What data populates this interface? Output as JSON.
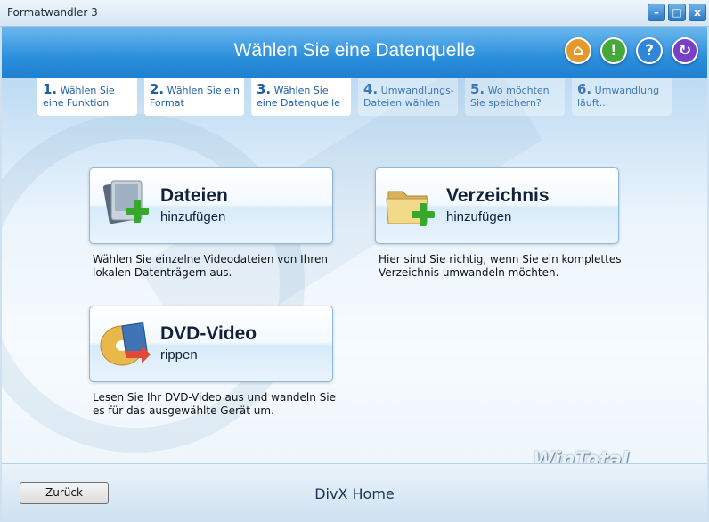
{
  "window": {
    "title": "Formatwandler 3",
    "min": "–",
    "max": "□",
    "close": "x"
  },
  "header": {
    "title": "Wählen Sie eine Datenquelle",
    "icons": [
      "home-icon",
      "info-icon",
      "help-icon",
      "refresh-icon"
    ],
    "icon_glyphs": {
      "home": "⌂",
      "info": "!",
      "help": "?",
      "refresh": "↻"
    },
    "colors": {
      "home": "#e39a2a",
      "info": "#46a83a",
      "help": "#2f85d8",
      "refresh": "#7a3fc7"
    }
  },
  "steps": [
    {
      "num": "1.",
      "label": "Wählen Sie eine Funktion",
      "state": "done"
    },
    {
      "num": "2.",
      "label": "Wählen Sie ein Format",
      "state": "done"
    },
    {
      "num": "3.",
      "label": "Wählen Sie eine Datenquelle",
      "state": "current"
    },
    {
      "num": "4.",
      "label": "Umwandlungs-Dateien wählen",
      "state": "todo"
    },
    {
      "num": "5.",
      "label": "Wo möchten Sie speichern?",
      "state": "todo"
    },
    {
      "num": "6.",
      "label": "Umwandlung läuft...",
      "state": "todo"
    }
  ],
  "options": {
    "files": {
      "title": "Dateien",
      "subtitle": "hinzufügen",
      "description": "Wählen Sie einzelne Videodateien von Ihren lokalen Datenträgern aus."
    },
    "folder": {
      "title": "Verzeichnis",
      "subtitle": "hinzufügen",
      "description": "Hier sind Sie richtig, wenn Sie ein komplettes Verzeichnis umwandeln möchten."
    },
    "dvd": {
      "title": "DVD-Video",
      "subtitle": "rippen",
      "description": "Lesen Sie Ihr DVD-Video aus und wandeln Sie es für das ausgewählte Gerät um."
    }
  },
  "footer": {
    "back": "Zurück",
    "brand": "DivX Home",
    "watermark": "WinTotal"
  }
}
